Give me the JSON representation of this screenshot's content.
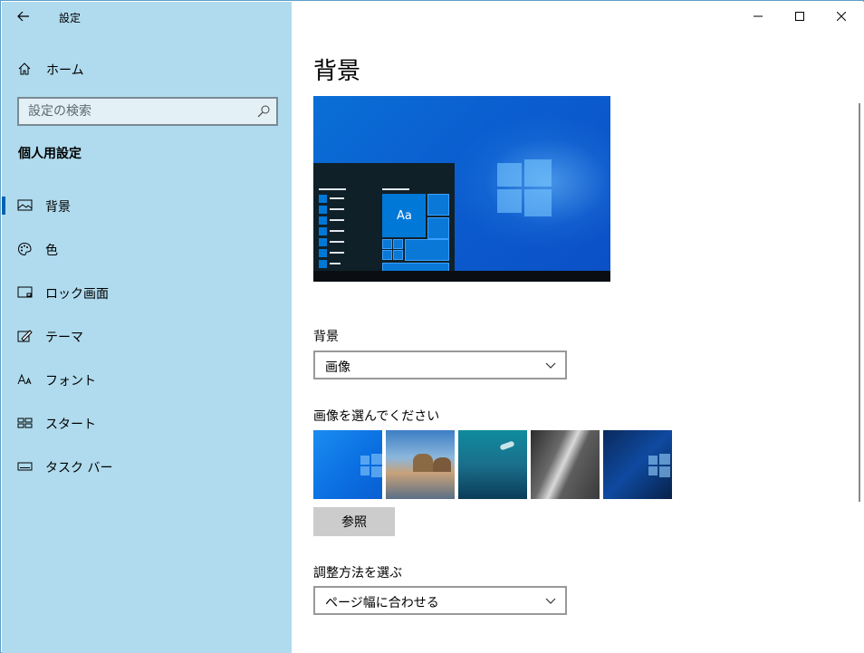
{
  "window": {
    "title": "設定"
  },
  "sidebar": {
    "home_label": "ホーム",
    "search_placeholder": "設定の検索",
    "section_title": "個人用設定",
    "items": [
      {
        "label": "背景",
        "icon": "picture-icon",
        "selected": true
      },
      {
        "label": "色",
        "icon": "palette-icon",
        "selected": false
      },
      {
        "label": "ロック画面",
        "icon": "lock-screen-icon",
        "selected": false
      },
      {
        "label": "テーマ",
        "icon": "theme-brush-icon",
        "selected": false
      },
      {
        "label": "フォント",
        "icon": "font-icon",
        "selected": false
      },
      {
        "label": "スタート",
        "icon": "start-icon",
        "selected": false
      },
      {
        "label": "タスク バー",
        "icon": "taskbar-icon",
        "selected": false
      }
    ]
  },
  "main": {
    "page_title": "背景",
    "preview_tile_text": "Aa",
    "background_label": "背景",
    "background_value": "画像",
    "choose_picture_label": "画像を選んでください",
    "browse_label": "参照",
    "fit_label": "調整方法を選ぶ",
    "fit_value": "ページ幅に合わせる"
  },
  "colors": {
    "sidebar_bg": "#b0dbee",
    "accent": "#0078d7"
  }
}
